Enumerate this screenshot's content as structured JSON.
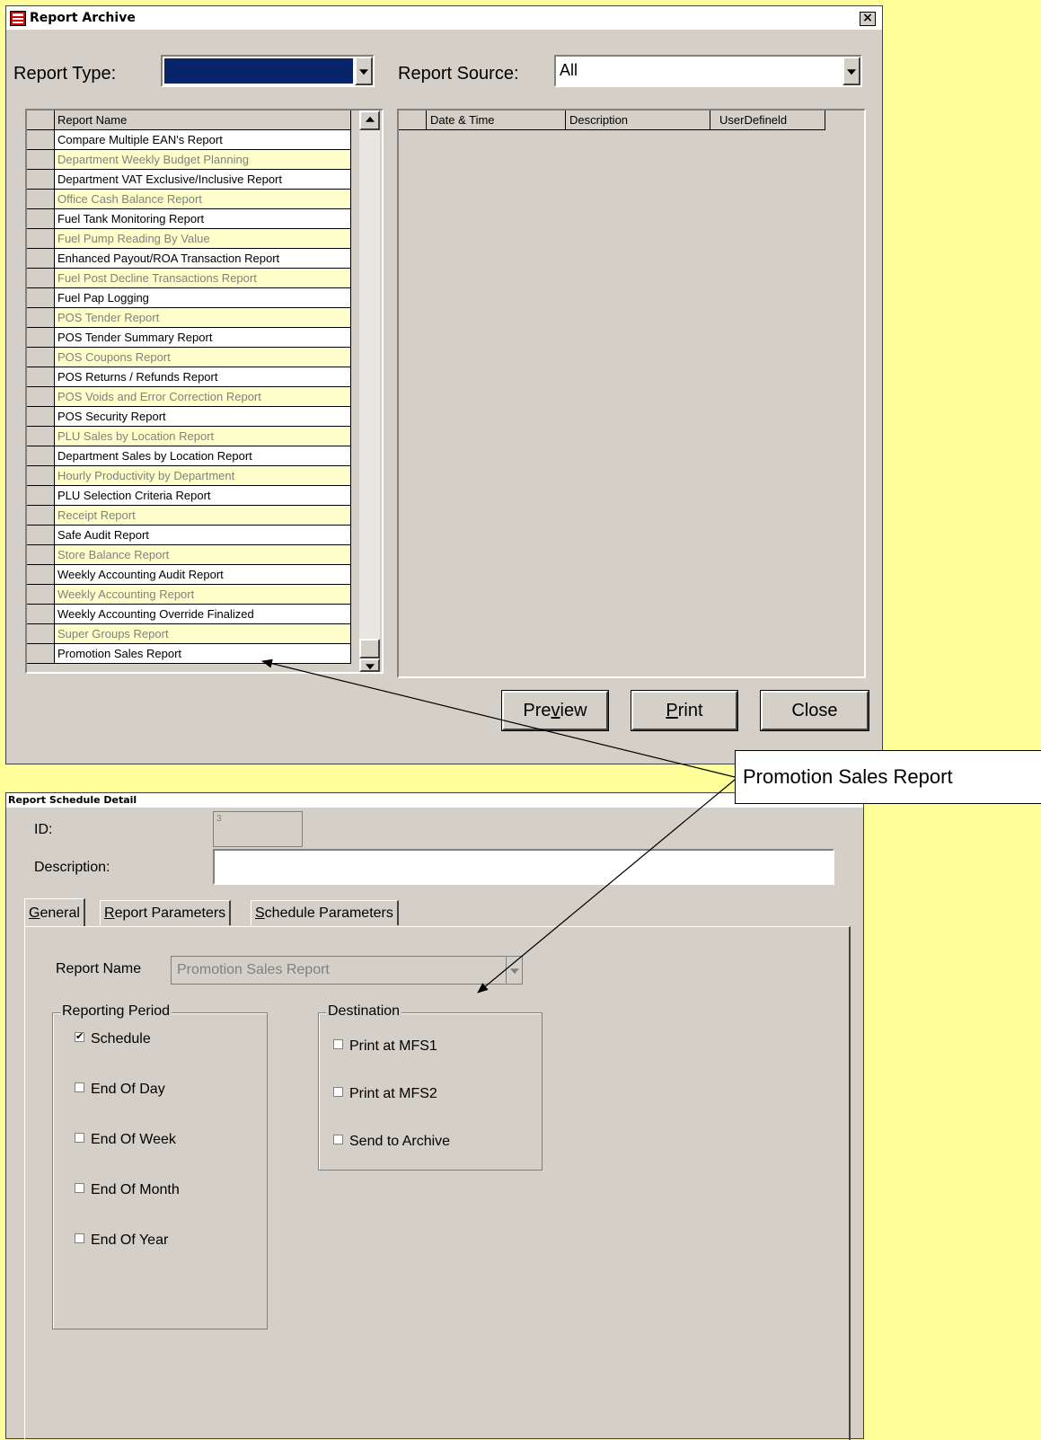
{
  "archive": {
    "title": "Report Archive",
    "close_glyph": "×",
    "report_type_label": "Report Type:",
    "report_type_value": "",
    "report_source_label": "Report Source:",
    "report_source_value": "All",
    "left_grid": {
      "header": "Report Name",
      "rows": [
        {
          "name": "Compare Multiple EAN's Report",
          "style": "white"
        },
        {
          "name": "Department Weekly Budget Planning",
          "style": "yellow"
        },
        {
          "name": "Department VAT Exclusive/Inclusive Report",
          "style": "white"
        },
        {
          "name": "Office Cash Balance Report",
          "style": "yellow"
        },
        {
          "name": "Fuel Tank Monitoring Report",
          "style": "white"
        },
        {
          "name": "Fuel Pump Reading By Value",
          "style": "yellow"
        },
        {
          "name": "Enhanced Payout/ROA Transaction Report",
          "style": "white"
        },
        {
          "name": "Fuel Post Decline Transactions Report",
          "style": "yellow"
        },
        {
          "name": "Fuel Pap Logging",
          "style": "white"
        },
        {
          "name": "POS Tender Report",
          "style": "yellow"
        },
        {
          "name": "POS Tender Summary Report",
          "style": "white"
        },
        {
          "name": "POS Coupons Report",
          "style": "yellow"
        },
        {
          "name": "POS Returns / Refunds Report",
          "style": "white"
        },
        {
          "name": "POS Voids and Error Correction Report",
          "style": "yellow"
        },
        {
          "name": "POS Security Report",
          "style": "white"
        },
        {
          "name": "PLU Sales by Location Report",
          "style": "yellow"
        },
        {
          "name": "Department Sales by Location Report",
          "style": "white"
        },
        {
          "name": "Hourly Productivity by Department",
          "style": "yellow"
        },
        {
          "name": "PLU Selection Criteria Report",
          "style": "white"
        },
        {
          "name": "Receipt Report",
          "style": "yellow"
        },
        {
          "name": "Safe Audit Report",
          "style": "white"
        },
        {
          "name": "Store Balance Report",
          "style": "yellow"
        },
        {
          "name": "Weekly Accounting Audit Report",
          "style": "white"
        },
        {
          "name": "Weekly Accounting Report",
          "style": "yellow"
        },
        {
          "name": "Weekly Accounting Override Finalized",
          "style": "white"
        },
        {
          "name": "Super Groups Report",
          "style": "yellow"
        },
        {
          "name": "Promotion Sales Report",
          "style": "white"
        }
      ]
    },
    "right_grid": {
      "columns": [
        "Date & Time",
        "Description",
        "UserDefineld"
      ]
    },
    "buttons": {
      "preview_pre": "Pre",
      "preview_ul": "v",
      "preview_post": "iew",
      "print_ul": "P",
      "print_post": "rint",
      "close": "Close"
    }
  },
  "callout": {
    "text": "Promotion Sales Report"
  },
  "detail": {
    "title": "Report Schedule Detail",
    "id_label": "ID:",
    "id_value": "3",
    "description_label": "Description:",
    "description_value": "",
    "tabs": [
      {
        "ul": "G",
        "rest": "eneral"
      },
      {
        "ul": "R",
        "rest": "eport Parameters"
      },
      {
        "ul": "S",
        "rest": "chedule Parameters"
      }
    ],
    "report_name_label": "Report Name",
    "report_name_value": "Promotion Sales Report",
    "reporting_period": {
      "title": "Reporting Period",
      "items": [
        {
          "label": "Schedule",
          "checked": true
        },
        {
          "label": "End Of Day",
          "checked": false
        },
        {
          "label": "End Of Week",
          "checked": false
        },
        {
          "label": "End Of Month",
          "checked": false
        },
        {
          "label": "End Of Year",
          "checked": false
        }
      ]
    },
    "destination": {
      "title": "Destination",
      "items": [
        {
          "label": "Print at MFS1",
          "checked": false
        },
        {
          "label": "Print at MFS2",
          "checked": false
        },
        {
          "label": "Send to Archive",
          "checked": false
        }
      ]
    }
  }
}
